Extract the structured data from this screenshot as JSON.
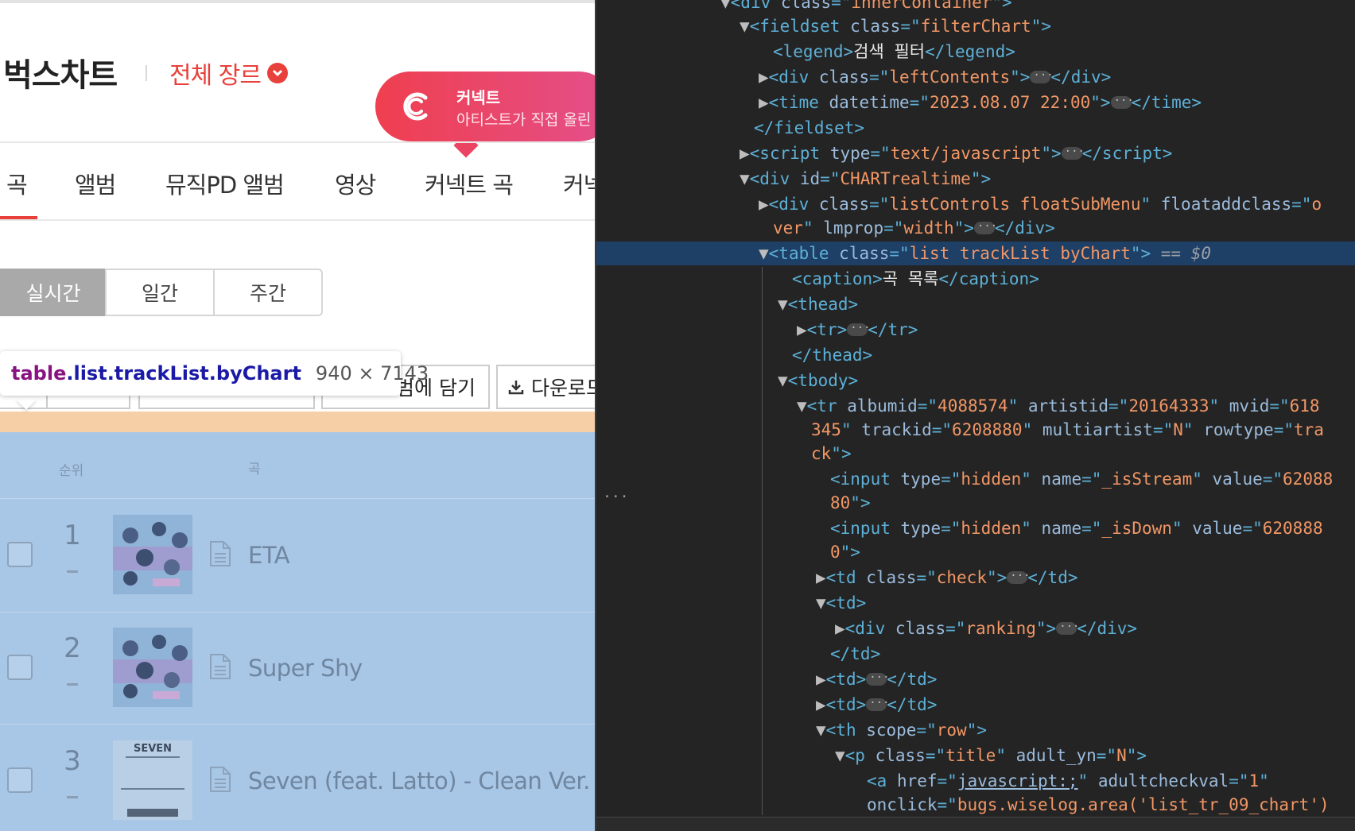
{
  "bugs": {
    "title": "벅스차트",
    "genre": "전체 장르",
    "banner": {
      "title": "커넥트",
      "subtitle": "아티스트가 직접 올린"
    },
    "tabs": [
      "곡",
      "앨범",
      "뮤직PD 앨범",
      "영상",
      "커넥트 곡",
      "커넥"
    ],
    "period_tabs": [
      "실시간",
      "일간",
      "주간"
    ],
    "controls": {
      "add_album_label": "범에 담기",
      "download_label": "다운로드"
    },
    "table_headers": {
      "rank": "순위",
      "song": "곡"
    },
    "rows": [
      {
        "rank": "1",
        "title": "ETA"
      },
      {
        "rank": "2",
        "title": "Super Shy"
      },
      {
        "rank": "3",
        "title": "Seven (feat. Latto) - Clean Ver."
      }
    ],
    "tooltip": {
      "tag": "table",
      "classes": ".list.trackList.byChart",
      "dims": "940 × 7143"
    },
    "cover3_text": "SEVEN"
  },
  "devtools": {
    "lines": [
      "<div class=\"innerContainer\">",
      "<fieldset class=\"filterChart\">",
      "<legend>검색 필터</legend>",
      "<div class=\"leftContents\">",
      "<time datetime=\"2023.08.07 22:00\">",
      "</fieldset>",
      "<script type=\"text/javascript\">",
      "<div id=\"CHARTrealtime\">",
      "<div class=\"listControls floatSubMenu\" floataddclass=\"o",
      "ver\" lmprop=\"width\">",
      "<table class=\"list trackList byChart\"> == $0",
      "<caption>곡 목록</caption>",
      "<thead>",
      "<tr>",
      "</thead>",
      "<tbody>",
      "<tr albumid=\"4088574\" artistid=\"20164333\" mvid=\"618",
      "345\" trackid=\"6208880\" multiartist=\"N\" rowtype=\"tra",
      "ck\">",
      "<input type=\"hidden\" name=\"_isStream\" value=\"62088",
      "80\">",
      "<input type=\"hidden\" name=\"_isDown\" value=\"620888",
      "0\">",
      "<td class=\"check\">",
      "<td>",
      "<div class=\"ranking\">",
      "</td>",
      "<td>",
      "<td>",
      "<th scope=\"row\">",
      "<p class=\"title\" adult_yn=\"N\">",
      "<a href=\"javascript:;\" adultcheckval=\"1\"",
      "onclick=\"bugs.wiselog.area('list_tr_09_chart')"
    ]
  },
  "colors": {
    "accent_red": "#e8403a",
    "table_highlight": "#a8c6e5",
    "margin_highlight": "#f6cfa6",
    "devtools_bg": "#242424",
    "devtools_selected": "#1e3f66"
  }
}
